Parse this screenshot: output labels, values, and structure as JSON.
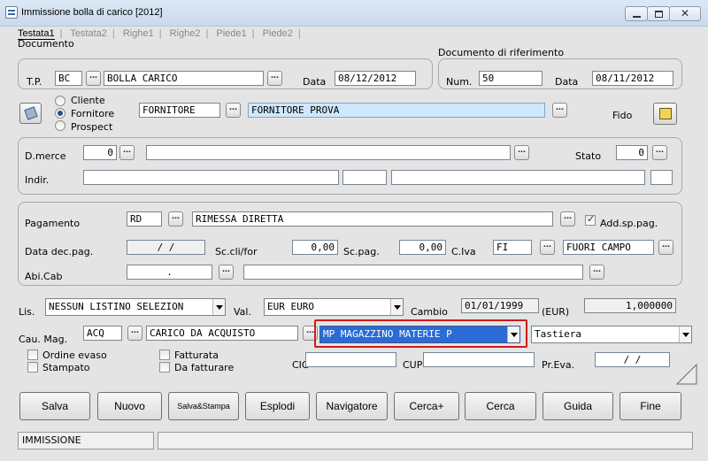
{
  "window": {
    "title": "Immissione bolla di carico [2012]",
    "controls": {
      "minimize": "minimize-icon",
      "maximize": "maximize-icon",
      "close": "close-icon"
    }
  },
  "tabs": [
    "Testata1",
    "Testata2",
    "Righe1",
    "Righe2",
    "Piede1",
    "Piede2"
  ],
  "documento": {
    "group_label": "Documento",
    "tp_label": "T.P.",
    "tp_code": "BC",
    "tp_desc": "BOLLA CARICO",
    "data_label": "Data",
    "data": "08/12/2012"
  },
  "doc_rif": {
    "group_label": "Documento di riferimento",
    "num_label": "Num.",
    "num": "50",
    "data_label": "Data",
    "data": "08/11/2012"
  },
  "soggetto": {
    "radio_cliente": "Cliente",
    "radio_fornitore": "Fornitore",
    "radio_prospect": "Prospect",
    "selected": "Fornitore",
    "code": "FORNITORE",
    "name": "FORNITORE PROVA",
    "fido_label": "Fido"
  },
  "dest_merce": {
    "dmerce_label": "D.merce",
    "dmerce_code": "0",
    "dmerce_desc": "",
    "stato_label": "Stato",
    "stato_code": "0",
    "indir_label": "Indir."
  },
  "pagamento": {
    "label": "Pagamento",
    "code": "RD",
    "desc": "RIMESSA DIRETTA",
    "addsp_label": "Add.sp.pag.",
    "addsp_checked": true,
    "data_dec_label": "Data dec.pag.",
    "data_dec": "/  /",
    "sc_clifor_label": "Sc.cli/for",
    "sc_clifor": "0,00",
    "sc_pag_label": "Sc.pag.",
    "sc_pag": "0,00",
    "civa_label": "C.Iva",
    "civa_code": "FI",
    "civa_desc": "FUORI CAMPO",
    "abicab_label": "Abi.Cab",
    "abicab": "."
  },
  "listino": {
    "lis_label": "Lis.",
    "lis_value": "NESSUN LISTINO SELEZION",
    "val_label": "Val.",
    "val_value": "EUR  EURO",
    "cambio_label": "Cambio",
    "cambio_date": "01/01/1999",
    "cambio_unit": "(EUR)",
    "cambio_value": "1,000000"
  },
  "causale": {
    "label": "Cau. Mag.",
    "code": "ACQ",
    "desc": "CARICO DA ACQUISTO",
    "magazzino": "MP   MAGAZZINO MATERIE P",
    "input_mode": "Tastiera"
  },
  "flags": {
    "ordine_evaso": "Ordine evaso",
    "stampato": "Stampato",
    "fatturata": "Fatturata",
    "da_fatturare": "Da fatturare",
    "cig_label": "CIG",
    "cup_label": "CUP",
    "preva_label": "Pr.Eva.",
    "preva": "/  /"
  },
  "buttons": {
    "salva": "Salva",
    "nuovo": "Nuovo",
    "salva_stampa": "Salva&Stampa",
    "esplodi": "Esplodi",
    "navigatore": "Navigatore",
    "cerca_plus": "Cerca+",
    "cerca": "Cerca",
    "guida": "Guida",
    "fine": "Fine"
  },
  "status": {
    "mode": "IMMISSIONE"
  },
  "colors": {
    "highlight_input": "#cfe8fb",
    "selected_combo_bg": "#2b6bd6",
    "focus_border": "#d11a1a"
  }
}
